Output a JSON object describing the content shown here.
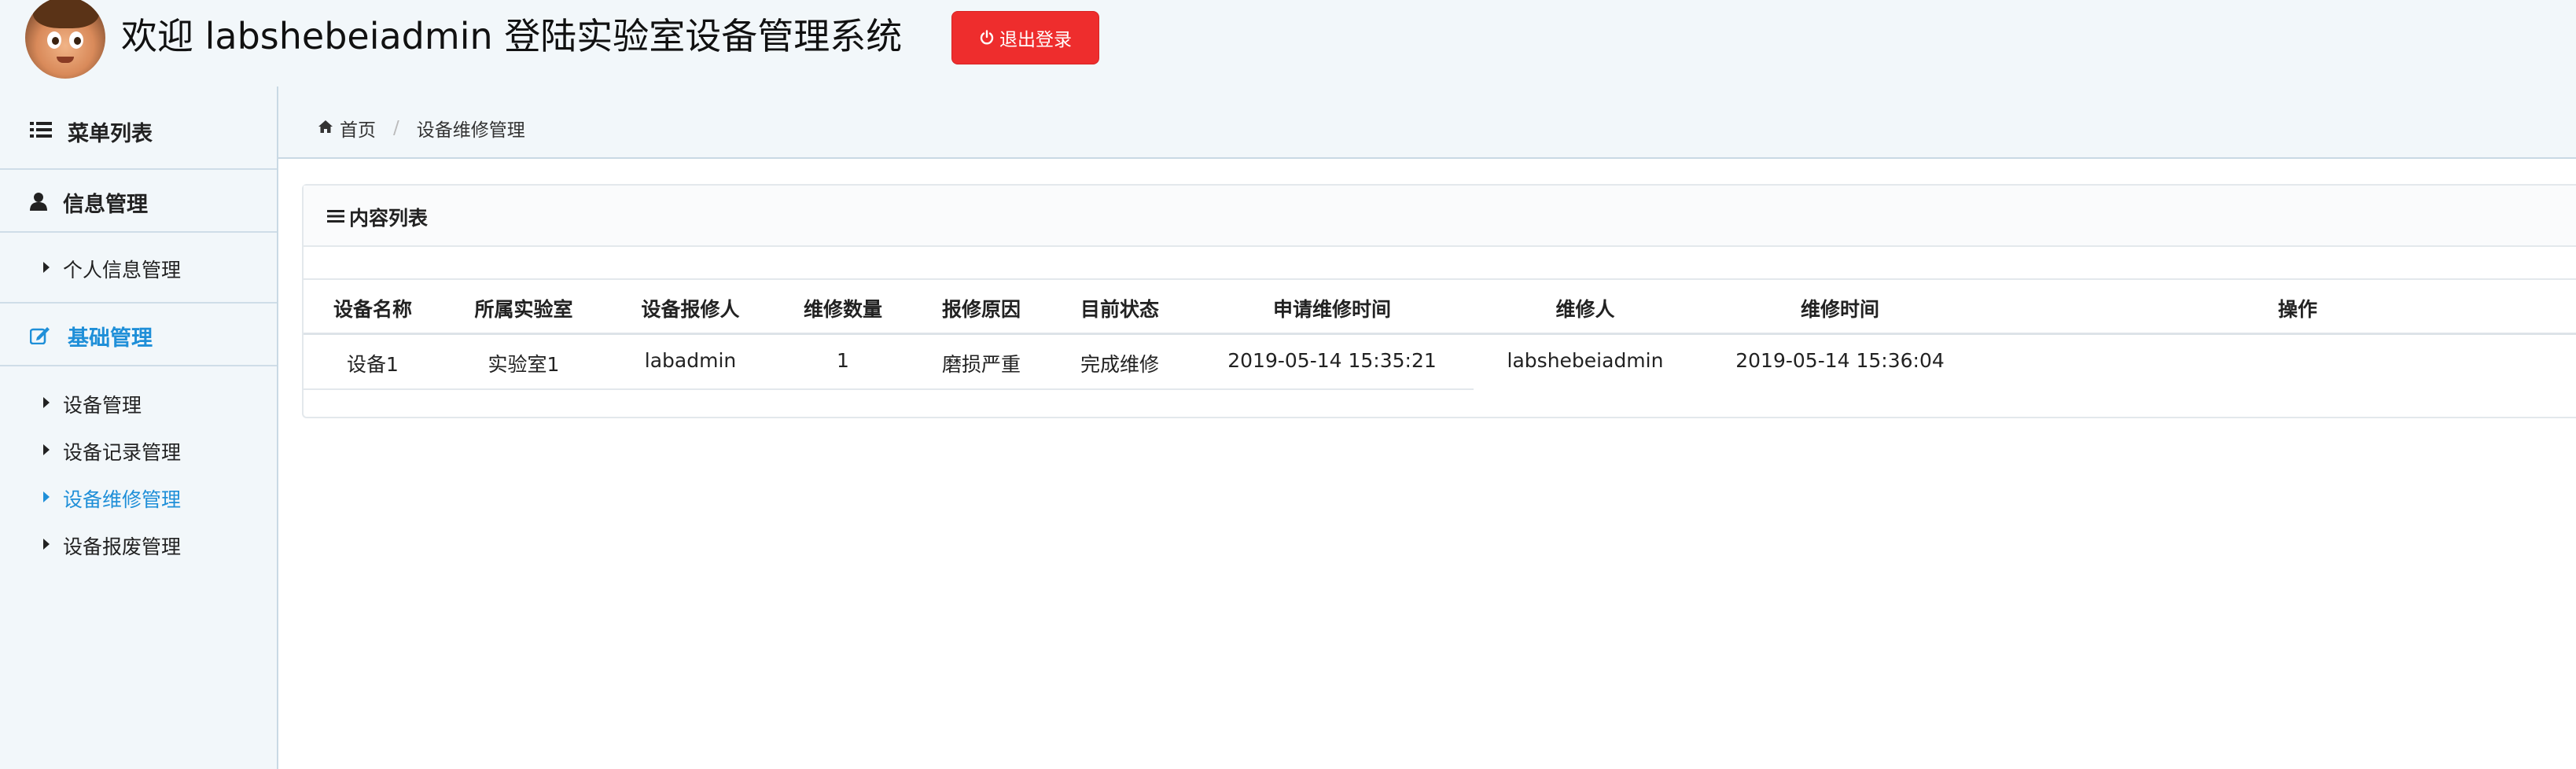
{
  "header": {
    "title": "欢迎 labshebeiadmin 登陆实验室设备管理系统",
    "logout_label": "退出登录",
    "logout_color": "#ee2d2d"
  },
  "sidebar": {
    "menu_title": "菜单列表",
    "sections": [
      {
        "label": "信息管理",
        "icon": "user-icon",
        "active": false,
        "items": [
          {
            "label": "个人信息管理",
            "active": false
          }
        ]
      },
      {
        "label": "基础管理",
        "icon": "edit-icon",
        "active": true,
        "items": [
          {
            "label": "设备管理",
            "active": false
          },
          {
            "label": "设备记录管理",
            "active": false
          },
          {
            "label": "设备维修管理",
            "active": true
          },
          {
            "label": "设备报废管理",
            "active": false
          }
        ]
      }
    ],
    "accent_color": "#1f8fd8"
  },
  "breadcrumb": {
    "home": "首页",
    "current": "设备维修管理"
  },
  "panel": {
    "title": "内容列表"
  },
  "table": {
    "columns": [
      "设备名称",
      "所属实验室",
      "设备报修人",
      "维修数量",
      "报修原因",
      "目前状态",
      "申请维修时间",
      "维修人",
      "维修时间",
      "操作"
    ],
    "rows": [
      [
        "设备1",
        "实验室1",
        "labadmin",
        "1",
        "磨损严重",
        "完成维修",
        "2019-05-14 15:35:21",
        "labshebeiadmin",
        "2019-05-14 15:36:04",
        ""
      ]
    ]
  }
}
